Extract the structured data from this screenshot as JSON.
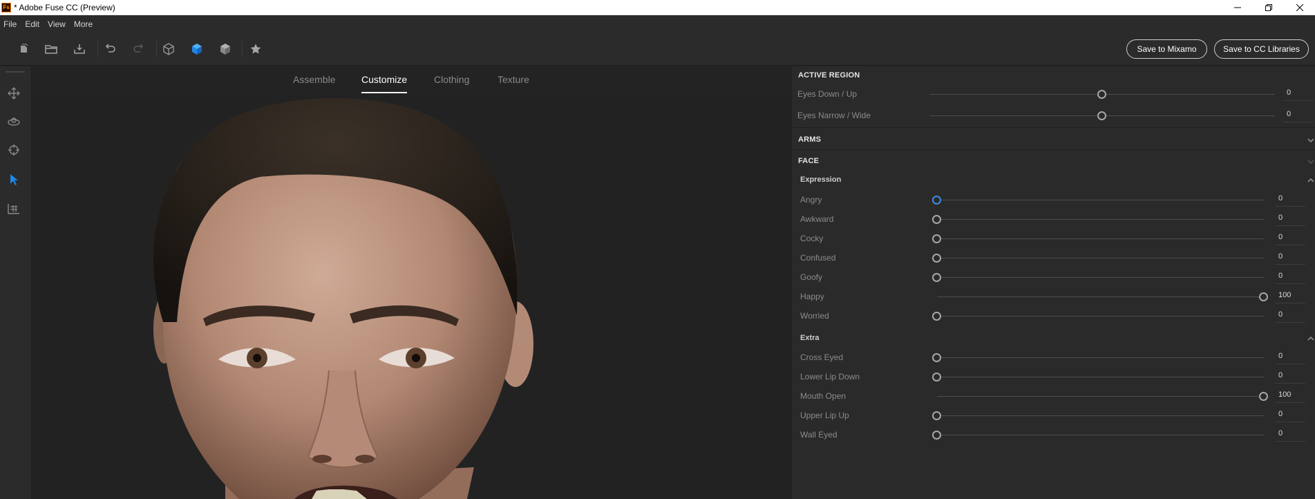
{
  "window": {
    "app_icon_text": "Fs",
    "title": "* Adobe Fuse CC (Preview)"
  },
  "menu": [
    "File",
    "Edit",
    "View",
    "More"
  ],
  "toolbar": {
    "save_mixamo": "Save to Mixamo",
    "save_cc": "Save to CC Libraries",
    "icons": [
      "new-document-icon",
      "open-folder-icon",
      "import-icon",
      "undo-icon",
      "redo-icon",
      "wireframe-cube-icon",
      "shaded-cube-icon",
      "textured-cube-icon",
      "favorite-star-icon"
    ],
    "accent_color": "#1e88e5"
  },
  "sidebar": {
    "icons": [
      "move-icon",
      "orbit-icon",
      "target-icon",
      "select-pointer-icon",
      "pose-icon"
    ],
    "active": "select-pointer-icon"
  },
  "tabs": [
    {
      "label": "Assemble",
      "active": false
    },
    {
      "label": "Customize",
      "active": true
    },
    {
      "label": "Clothing",
      "active": false
    },
    {
      "label": "Texture",
      "active": false
    }
  ],
  "panel": {
    "active_region": {
      "title": "ACTIVE REGION",
      "rows": [
        {
          "label": "Eyes Down / Up",
          "value": "0",
          "fraction": 0.5
        },
        {
          "label": "Eyes Narrow / Wide",
          "value": "0",
          "fraction": 0.5
        }
      ]
    },
    "arms": {
      "title": "ARMS"
    },
    "face": {
      "title": "FACE",
      "expression": {
        "title": "Expression",
        "rows": [
          {
            "label": "Angry",
            "value": "0",
            "fraction": 0,
            "active": true
          },
          {
            "label": "Awkward",
            "value": "0",
            "fraction": 0
          },
          {
            "label": "Cocky",
            "value": "0",
            "fraction": 0
          },
          {
            "label": "Confused",
            "value": "0",
            "fraction": 0
          },
          {
            "label": "Goofy",
            "value": "0",
            "fraction": 0
          },
          {
            "label": "Happy",
            "value": "100",
            "fraction": 1
          },
          {
            "label": "Worried",
            "value": "0",
            "fraction": 0
          }
        ]
      },
      "extra": {
        "title": "Extra",
        "rows": [
          {
            "label": "Cross Eyed",
            "value": "0",
            "fraction": 0
          },
          {
            "label": "Lower Lip Down",
            "value": "0",
            "fraction": 0
          },
          {
            "label": "Mouth Open",
            "value": "100",
            "fraction": 1
          },
          {
            "label": "Upper Lip Up",
            "value": "0",
            "fraction": 0
          },
          {
            "label": "Wall Eyed",
            "value": "0",
            "fraction": 0
          }
        ]
      }
    }
  }
}
